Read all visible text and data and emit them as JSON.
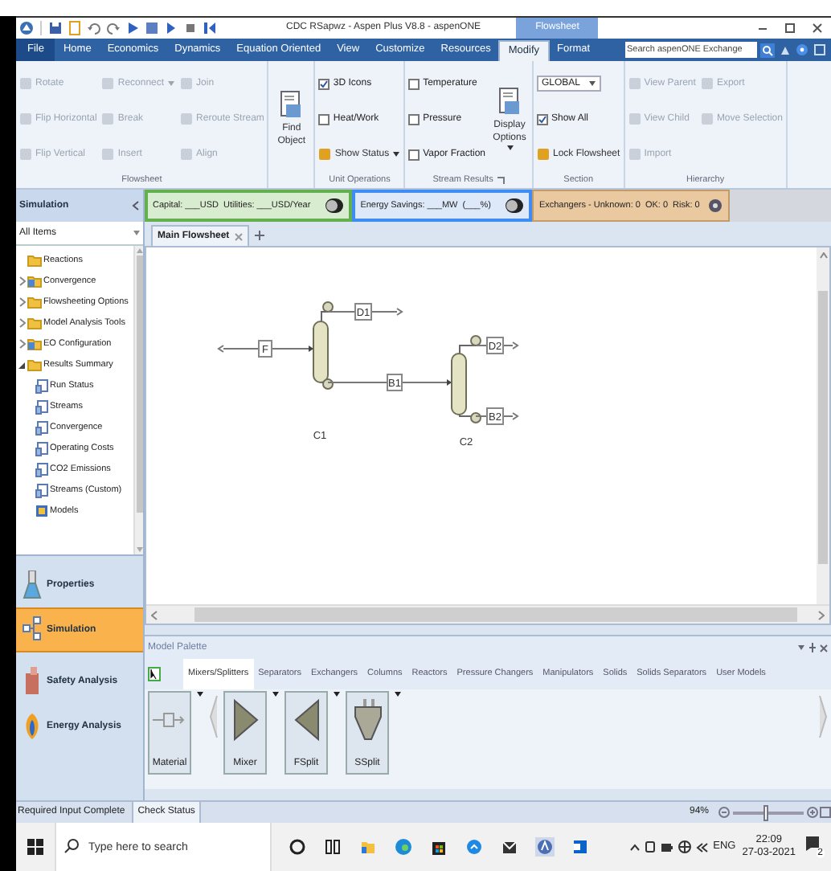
{
  "window": {
    "title": "CDC RSapwz - Aspen Plus V8.8 - aspenONE",
    "context_tab": "Flowsheet"
  },
  "ribbon_tabs": [
    {
      "label": "File",
      "kind": "file",
      "selected": false
    },
    {
      "label": "Home",
      "kind": "tab",
      "selected": false
    },
    {
      "label": "Economics",
      "kind": "tab",
      "selected": false
    },
    {
      "label": "Dynamics",
      "kind": "tab",
      "selected": false
    },
    {
      "label": "Equation Oriented",
      "kind": "tab",
      "selected": false
    },
    {
      "label": "View",
      "kind": "tab",
      "selected": false
    },
    {
      "label": "Customize",
      "kind": "tab",
      "selected": false
    },
    {
      "label": "Resources",
      "kind": "tab",
      "selected": false
    },
    {
      "label": "Modify",
      "kind": "tab",
      "selected": true
    },
    {
      "label": "Format",
      "kind": "tab",
      "selected": false
    }
  ],
  "search": {
    "placeholder": "Search aspenONE Exchange"
  },
  "ribbon_groups": [
    {
      "label": "Flowsheet",
      "items": [
        {
          "kind": "button",
          "label": "Rotate",
          "disabled": true
        },
        {
          "kind": "button",
          "label": "Flip Horizontal",
          "disabled": true
        },
        {
          "kind": "button",
          "label": "Flip Vertical",
          "disabled": true
        },
        {
          "kind": "button",
          "label": "Reconnect",
          "disabled": true,
          "dropdown": true
        },
        {
          "kind": "button",
          "label": "Break",
          "disabled": true
        },
        {
          "kind": "button",
          "label": "Insert",
          "disabled": true
        },
        {
          "kind": "button",
          "label": "Join",
          "disabled": true
        },
        {
          "kind": "button",
          "label": "Reroute Stream",
          "disabled": true
        },
        {
          "kind": "button",
          "label": "Align",
          "disabled": true
        }
      ]
    },
    {
      "items": [
        {
          "kind": "large",
          "label": "Find Object"
        }
      ]
    },
    {
      "label": "Unit Operations",
      "items": [
        {
          "kind": "check",
          "label": "3D Icons",
          "checked": true
        },
        {
          "kind": "check",
          "label": "Heat/Work",
          "checked": false
        },
        {
          "kind": "button",
          "label": "Show Status",
          "disabled": false,
          "dropdown": true
        }
      ]
    },
    {
      "label": "Stream Results",
      "launcher": true,
      "items": [
        {
          "kind": "check",
          "label": "Temperature",
          "checked": false
        },
        {
          "kind": "check",
          "label": "Pressure",
          "checked": false
        },
        {
          "kind": "check",
          "label": "Vapor Fraction",
          "checked": false
        },
        {
          "kind": "large",
          "label": "Display Options",
          "dropdown": true
        }
      ]
    },
    {
      "label": "Section",
      "items": [
        {
          "kind": "select",
          "label": "GLOBAL"
        },
        {
          "kind": "check",
          "label": "Show All",
          "checked": true
        },
        {
          "kind": "button",
          "label": "Lock Flowsheet",
          "disabled": false
        }
      ]
    },
    {
      "label": "Hierarchy",
      "items": [
        {
          "kind": "button",
          "label": "View Parent",
          "disabled": true
        },
        {
          "kind": "button",
          "label": "View Child",
          "disabled": true
        },
        {
          "kind": "button",
          "label": "Import",
          "disabled": true
        },
        {
          "kind": "button",
          "label": "Export",
          "disabled": true
        },
        {
          "kind": "button",
          "label": "Move Selection",
          "disabled": true
        }
      ]
    }
  ],
  "energy_bar": [
    {
      "kind": "capital",
      "texts": [
        "Capital: ___USD",
        "Utilities: ___USD/Year"
      ],
      "on": false
    },
    {
      "kind": "energy",
      "texts": [
        "Energy Savings: ___MW",
        "(___%)"
      ],
      "on": false
    },
    {
      "kind": "exchangers",
      "texts": [
        "Exchangers - Unknown: 0",
        "OK: 0",
        "Risk: 0"
      ]
    }
  ],
  "navigator": {
    "title": "Simulation",
    "filter": "All Items",
    "tree": [
      {
        "label": "Reactions",
        "kind": "folder"
      },
      {
        "label": "Convergence",
        "kind": "special",
        "expanded": false
      },
      {
        "label": "Flowsheeting Options",
        "kind": "folder",
        "expanded": false
      },
      {
        "label": "Model Analysis Tools",
        "kind": "folder",
        "expanded": false
      },
      {
        "label": "EO Configuration",
        "kind": "special",
        "expanded": false
      },
      {
        "label": "Results Summary",
        "kind": "folder",
        "expanded": true,
        "children": [
          {
            "label": "Run Status",
            "kind": "sheet"
          },
          {
            "label": "Streams",
            "kind": "sheet"
          },
          {
            "label": "Convergence",
            "kind": "sheet"
          },
          {
            "label": "Operating Costs",
            "kind": "sheet"
          },
          {
            "label": "CO2 Emissions",
            "kind": "sheet"
          },
          {
            "label": "Streams (Custom)",
            "kind": "sheet"
          },
          {
            "label": "Models",
            "kind": "model"
          }
        ]
      }
    ],
    "sections": [
      {
        "label": "Properties",
        "selected": false
      },
      {
        "label": "Simulation",
        "selected": true
      },
      {
        "label": "Safety Analysis",
        "selected": false
      },
      {
        "label": "Energy Analysis",
        "selected": false
      }
    ]
  },
  "document_tabs": [
    {
      "label": "Main Flowsheet",
      "selected": true
    }
  ],
  "flowsheet": {
    "blocks": [
      {
        "label": "C1"
      },
      {
        "label": "C2"
      }
    ],
    "streams": [
      {
        "label": "F"
      },
      {
        "label": "D1"
      },
      {
        "label": "B1"
      },
      {
        "label": "D2"
      },
      {
        "label": "B2"
      }
    ]
  },
  "palette": {
    "title": "Model Palette",
    "tabs": [
      {
        "label": "Mixers/Splitters",
        "selected": true
      },
      {
        "label": "Separators",
        "selected": false
      },
      {
        "label": "Exchangers",
        "selected": false
      },
      {
        "label": "Columns",
        "selected": false
      },
      {
        "label": "Reactors",
        "selected": false
      },
      {
        "label": "Pressure Changers",
        "selected": false
      },
      {
        "label": "Manipulators",
        "selected": false
      },
      {
        "label": "Solids",
        "selected": false
      },
      {
        "label": "Solids Separators",
        "selected": false
      },
      {
        "label": "User Models",
        "selected": false
      }
    ],
    "models": [
      {
        "kind": "material",
        "label": "Material"
      },
      {
        "kind": "mixer",
        "label": "Mixer"
      },
      {
        "kind": "fsplit",
        "label": "FSplit"
      },
      {
        "kind": "ssplit",
        "label": "SSplit"
      }
    ]
  },
  "status_bar": {
    "message": "Required Input Complete",
    "tabs": [
      {
        "label": "Check Status"
      }
    ],
    "zoom": {
      "reading": "94%",
      "level": 0.45
    }
  },
  "taskbar": {
    "search_placeholder": "Type here to search",
    "language": "ENG",
    "time": "22:09",
    "date": "27-03-2021",
    "notifications": "2"
  }
}
